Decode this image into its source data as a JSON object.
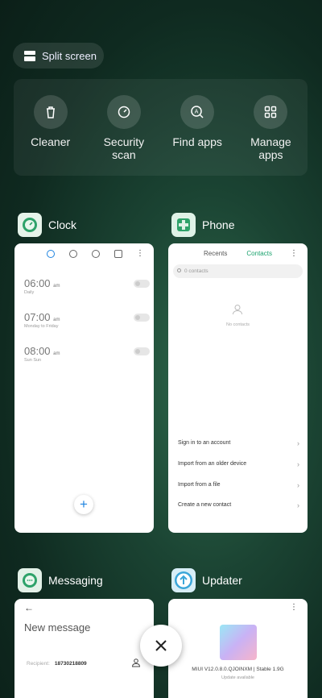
{
  "top": {
    "split_screen_label": "Split screen"
  },
  "tools": [
    {
      "label": "Cleaner",
      "icon": "trash-icon"
    },
    {
      "label": "Security scan",
      "icon": "shield-icon"
    },
    {
      "label": "Find apps",
      "icon": "find-apps-icon"
    },
    {
      "label": "Manage apps",
      "icon": "grid-icon"
    }
  ],
  "apps": {
    "clock": {
      "name": "Clock",
      "alarms": [
        {
          "time": "06:00",
          "ampm": "am",
          "repeat": "Daily"
        },
        {
          "time": "07:00",
          "ampm": "am",
          "repeat": "Monday to Friday"
        },
        {
          "time": "08:00",
          "ampm": "am",
          "repeat": "Sun Sun"
        }
      ]
    },
    "phone": {
      "name": "Phone",
      "tab_recents": "Recents",
      "tab_contacts": "Contacts",
      "search_placeholder": "0 contacts",
      "empty_text": "No contacts",
      "actions": [
        "Sign in to an account",
        "Import from an older device",
        "Import from a file",
        "Create a new contact"
      ]
    },
    "messaging": {
      "name": "Messaging",
      "title": "New message",
      "recipient_label": "Recipient:",
      "recipient_value": "18730218809"
    },
    "updater": {
      "name": "Updater",
      "version": "MIUI V12.0.8.0.QJOINXM | Stable 1.9G",
      "status": "Update available"
    }
  },
  "colors": {
    "accent_blue": "#1f84e0",
    "accent_green": "#1aa26d"
  }
}
